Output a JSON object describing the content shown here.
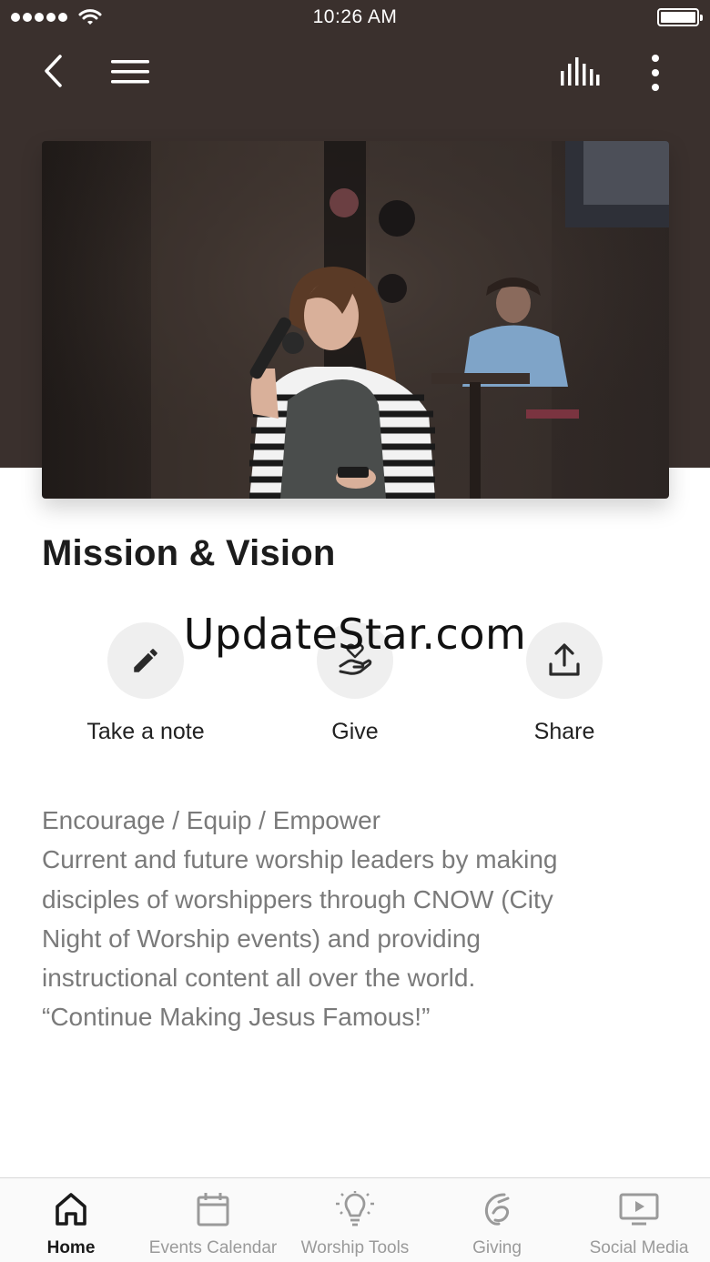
{
  "status_bar": {
    "time": "10:26 AM",
    "signal_icon": "signal-dots-icon",
    "wifi_icon": "wifi-icon",
    "battery_icon": "battery-icon",
    "battery_level": 1.0
  },
  "nav": {
    "back_icon": "chevron-left-icon",
    "menu_icon": "hamburger-menu-icon",
    "audio_icon": "audio-bars-icon",
    "more_icon": "more-vertical-icon"
  },
  "hero": {
    "image": "woman-singing-with-microphone-on-stage-photo"
  },
  "page": {
    "title": "Mission & Vision"
  },
  "watermark": "UpdateStar.com",
  "actions": [
    {
      "label": "Take a note",
      "icon": "pencil-icon"
    },
    {
      "label": "Give",
      "icon": "hand-heart-icon"
    },
    {
      "label": "Share",
      "icon": "share-upload-icon"
    }
  ],
  "body": {
    "lines": [
      "Encourage / Equip / Empower",
      "Current and future worship leaders by making",
      "disciples of worshippers through CNOW (City",
      "Night of Worship events) and providing",
      "instructional content all over the world.",
      "“Continue Making Jesus Famous!”"
    ]
  },
  "tabs": [
    {
      "label": "Home",
      "icon": "home-icon",
      "active": true
    },
    {
      "label": "Events Calendar",
      "icon": "calendar-icon",
      "active": false
    },
    {
      "label": "Worship Tools",
      "icon": "lightbulb-icon",
      "active": false
    },
    {
      "label": "Giving",
      "icon": "giving-icon",
      "active": false
    },
    {
      "label": "Social Media",
      "icon": "play-screen-icon",
      "active": false
    }
  ],
  "colors": {
    "header_bg": "#3a302d",
    "title": "#1c1c1c",
    "body_text": "#7a7a7a",
    "tab_active": "#1a1a1a",
    "tab_inactive": "#9a9a9a",
    "action_circle": "#efefef"
  }
}
